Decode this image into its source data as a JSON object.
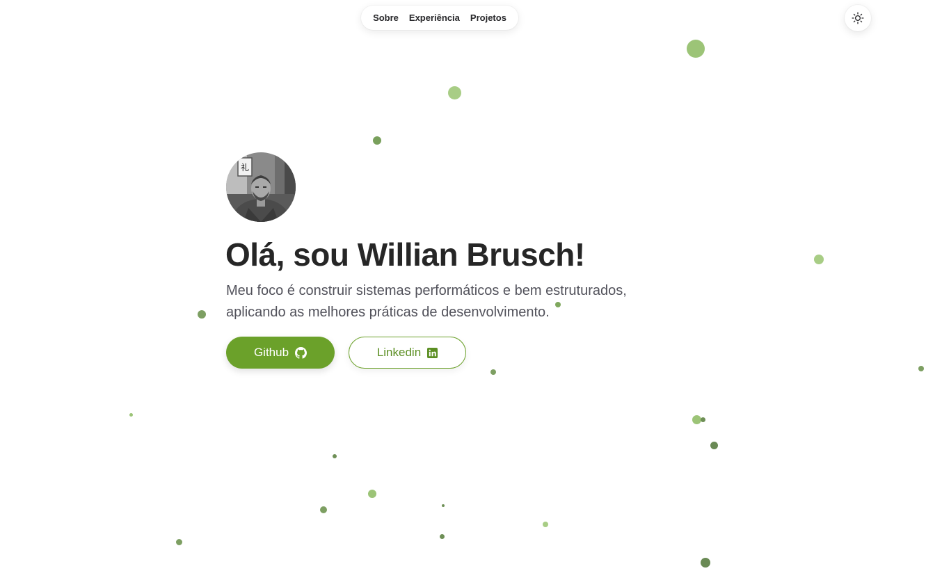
{
  "nav": {
    "items": [
      {
        "label": "Sobre"
      },
      {
        "label": "Experiência"
      },
      {
        "label": "Projetos"
      }
    ]
  },
  "theme_toggle": {
    "icon": "sun-icon"
  },
  "hero": {
    "avatar_icon": "profile-photo",
    "title": "Olá, sou Willian Brusch!",
    "subtitle_line1": "Meu foco é construir sistemas performáticos e bem estruturados,",
    "subtitle_line2": "aplicando as melhores práticas de desenvolvimento."
  },
  "buttons": {
    "github": {
      "label": "Github",
      "icon": "github-icon"
    },
    "linkedin": {
      "label": "Linkedin",
      "icon": "linkedin-icon"
    }
  },
  "colors": {
    "accent": "#6ba12a",
    "particle_light": "#9cc477",
    "particle_dark": "#6e8f56"
  }
}
